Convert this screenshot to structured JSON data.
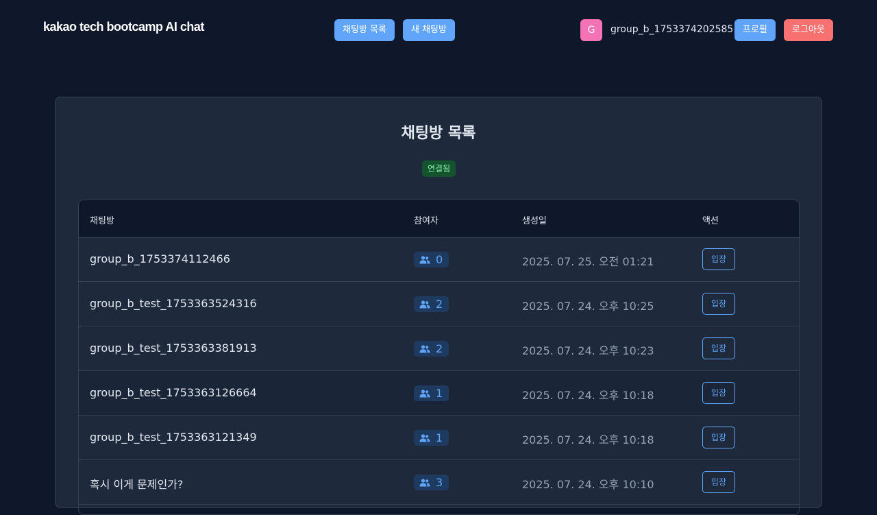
{
  "header": {
    "logo": "kakao tech bootcamp AI chat",
    "nav": {
      "room_list_label": "채팅방 목록",
      "new_room_label": "새 채팅방"
    },
    "user": {
      "avatar_initial": "G",
      "username": "group_b_1753374202585",
      "profile_label": "프로필",
      "logout_label": "로그아웃"
    }
  },
  "main": {
    "title": "채팅방 목록",
    "connection_status": "연결됨",
    "table": {
      "columns": [
        "채팅방",
        "참여자",
        "생성일",
        "액션"
      ],
      "rows": [
        {
          "name": "group_b_1753374112466",
          "participants": "0",
          "created": "2025. 07. 25. 오전 01:21",
          "action": "입장"
        },
        {
          "name": "group_b_test_1753363524316",
          "participants": "2",
          "created": "2025. 07. 24. 오후 10:25",
          "action": "입장"
        },
        {
          "name": "group_b_test_1753363381913",
          "participants": "2",
          "created": "2025. 07. 24. 오후 10:23",
          "action": "입장"
        },
        {
          "name": "group_b_test_1753363126664",
          "participants": "1",
          "created": "2025. 07. 24. 오후 10:18",
          "action": "입장"
        },
        {
          "name": "group_b_test_1753363121349",
          "participants": "1",
          "created": "2025. 07. 24. 오후 10:18",
          "action": "입장"
        },
        {
          "name": "혹시 이게 문제인가?",
          "participants": "3",
          "created": "2025. 07. 24. 오후 10:10",
          "action": "입장"
        }
      ]
    }
  },
  "colors": {
    "background": "#0f172a",
    "card": "#1e293b",
    "accent": "#60a5fa",
    "danger": "#f87171",
    "connected": "#86efac",
    "avatar": "#f472b6"
  }
}
